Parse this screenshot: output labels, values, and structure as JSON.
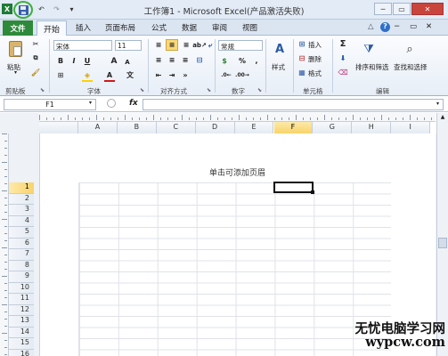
{
  "title_bar": {
    "title": "工作簿1 - Microsoft Excel(产品激活失败)",
    "quick_access": {
      "save": "save",
      "undo_icon": "↶",
      "redo_icon": "↷",
      "customize_icon": "▾"
    },
    "window_controls": {
      "minimize": "─",
      "restore": "▭",
      "close": "✕"
    }
  },
  "tabs": {
    "file": "文件",
    "items": [
      "开始",
      "插入",
      "页面布局",
      "公式",
      "数据",
      "审阅",
      "视图"
    ],
    "right_icons": [
      "△",
      "?",
      "─",
      "▭",
      "✕"
    ]
  },
  "ribbon": {
    "clipboard": {
      "paste": "粘贴",
      "cut_icon": "✂",
      "group": "剪贴板"
    },
    "font": {
      "name": "宋体",
      "size": "11",
      "bold": "B",
      "italic": "I",
      "underline": "U",
      "grow": "A",
      "shrink": "A",
      "font_color": "A",
      "group": "字体"
    },
    "alignment": {
      "group": "对齐方式"
    },
    "number": {
      "format": "常规",
      "currency": "$",
      "percent": "%",
      "comma": ",",
      "group": "数字"
    },
    "styles": {
      "label": "样式"
    },
    "cells": {
      "insert": "插入",
      "delete": "删除",
      "format": "格式",
      "group": "单元格"
    },
    "editing": {
      "sigma": "Σ",
      "sort_filter": "排序和筛选",
      "find_select": "查找和选择",
      "group": "编辑"
    }
  },
  "formula_bar": {
    "name_box": "F1",
    "fx": "fx",
    "value": ""
  },
  "columns": [
    "A",
    "B",
    "C",
    "D",
    "E",
    "F",
    "G",
    "H",
    "I"
  ],
  "selected_column": "F",
  "rows": [
    "1",
    "2",
    "3",
    "4",
    "5",
    "6",
    "7",
    "8",
    "9",
    "10",
    "11",
    "12",
    "13",
    "14",
    "15",
    "16"
  ],
  "selected_row": "1",
  "header_hint": "单击可添加页眉",
  "watermark": {
    "line1": "无忧电脑学习网",
    "line2": "wypcw.com"
  }
}
